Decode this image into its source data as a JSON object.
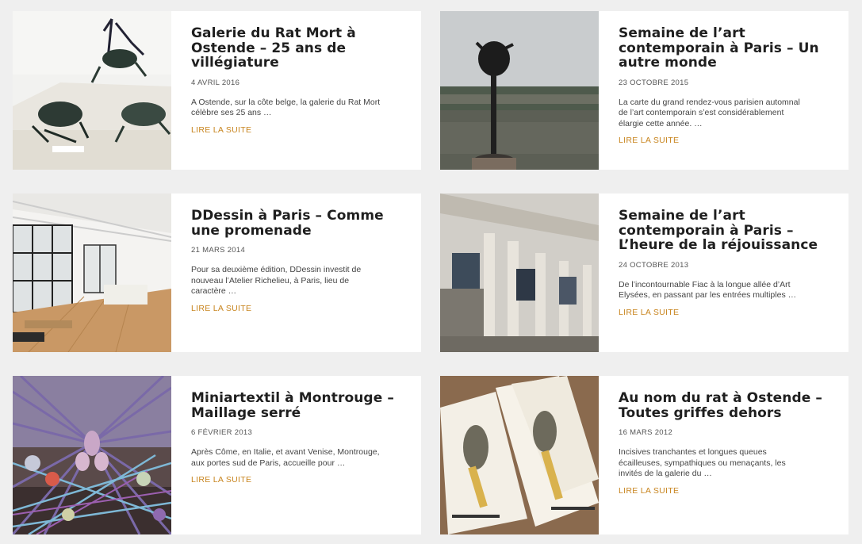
{
  "articles": [
    {
      "title": "Galerie du Rat Mort à Ostende – 25 ans de villégiature",
      "date": "4 AVRIL 2016",
      "excerpt": "A Ostende, sur la côte belge, la galerie du Rat Mort célèbre ses 25 ans …",
      "more": "LIRE LA SUITE",
      "image": "rat-sculptures-photo"
    },
    {
      "title": "Semaine de l’art contemporain à Paris – Un autre monde",
      "date": "23 OCTOBRE 2015",
      "excerpt": "La carte du grand rendez-vous parisien automnal de l’art contemporain s’est considérablement élargie cette année. …",
      "more": "LIRE LA SUITE",
      "image": "sculpture-by-pond-photo"
    },
    {
      "title": "DDessin à Paris – Comme une promenade",
      "date": "21 MARS 2014",
      "excerpt": "Pour sa deuxième édition, DDessin investit de nouveau l’Atelier Richelieu, à Paris, lieu de caractère …",
      "more": "LIRE LA SUITE",
      "image": "loft-interior-photo"
    },
    {
      "title": "Semaine de l’art contemporain à Paris – L’heure de la réjouissance",
      "date": "24 OCTOBRE 2013",
      "excerpt": "De l’incontournable Fiac à la longue allée d’Art Elysées, en passant par les entrées multiples …",
      "more": "LIRE LA SUITE",
      "image": "grand-palais-photo"
    },
    {
      "title": "Miniartextil à Montrouge – Maillage serré",
      "date": "6 FÉVRIER 2013",
      "excerpt": "Après Côme, en Italie, et avant Venise, Montrouge, aux portes sud de Paris, accueille pour …",
      "more": "LIRE LA SUITE",
      "image": "textile-installation-photo"
    },
    {
      "title": "Au nom du rat à Ostende – Toutes griffes dehors",
      "date": "16 MARS 2012",
      "excerpt": "Incisives tranchantes et longues queues écailleuses, sympathiques ou menaçants, les invités de la galerie du …",
      "more": "LIRE LA SUITE",
      "image": "exhibition-flyers-photo"
    }
  ]
}
